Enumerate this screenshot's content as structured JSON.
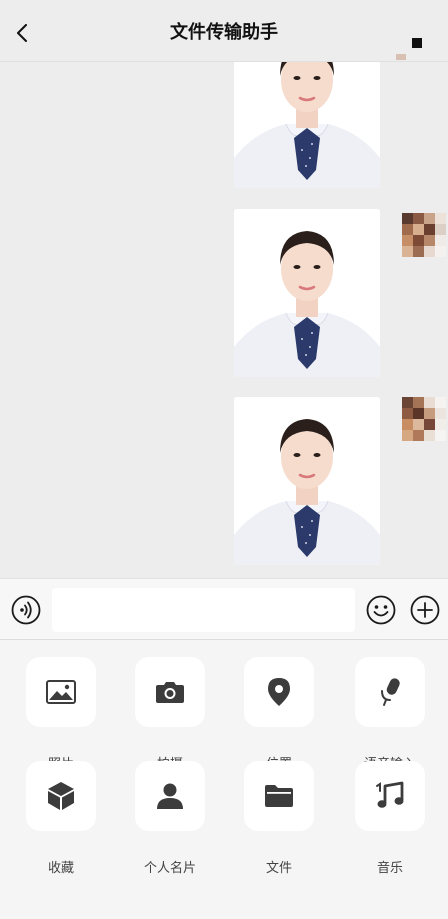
{
  "header": {
    "title": "文件传输助手"
  },
  "chat": {
    "messages": [
      {
        "type": "image",
        "sender": "self"
      },
      {
        "type": "image",
        "sender": "self"
      },
      {
        "type": "image",
        "sender": "self"
      }
    ]
  },
  "input_bar": {
    "placeholder": ""
  },
  "panel": {
    "tools": [
      {
        "label": "照片",
        "icon": "photo-icon"
      },
      {
        "label": "拍摄",
        "icon": "camera-icon"
      },
      {
        "label": "位置",
        "icon": "location-icon"
      },
      {
        "label": "语音输入",
        "icon": "microphone-icon"
      },
      {
        "label": "收藏",
        "icon": "favorites-icon"
      },
      {
        "label": "个人名片",
        "icon": "contact-card-icon"
      },
      {
        "label": "文件",
        "icon": "folder-icon"
      },
      {
        "label": "音乐",
        "icon": "music-icon"
      }
    ]
  },
  "colors": {
    "background": "#ededed",
    "panel": "#f5f5f5",
    "icon": "#3c3c3c",
    "tie": "#2b3a6b"
  }
}
